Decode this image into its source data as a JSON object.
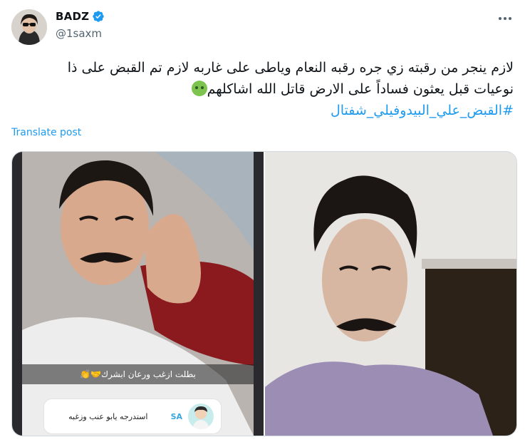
{
  "author": {
    "name": "BADZ",
    "handle": "@1saxm",
    "verified": true
  },
  "tweet": {
    "line1": "لازم ينجر من رقبته زي جره رقبه النعام وياطى على غاربه لازم تم القبض على ذا",
    "line2": "نوعيات قبل يعثون فساداً على الارض قاتل الله اشاكلهم",
    "emoji": "nauseated-face-emoji",
    "hashtag": "#القبض_علي_البيدوفيلي_شفتال"
  },
  "translate_label": "Translate post",
  "media": {
    "left_photo": {
      "story_caption": "بطلت ازغب ورعان ابشرك🤝👏",
      "reply_card": {
        "name": "SA",
        "text": "استدرجه يابو عنب وزغبه"
      }
    }
  },
  "colors": {
    "link": "#1d9bf0",
    "text": "#0f1419",
    "secondary": "#536471",
    "border": "#cfd9de"
  }
}
